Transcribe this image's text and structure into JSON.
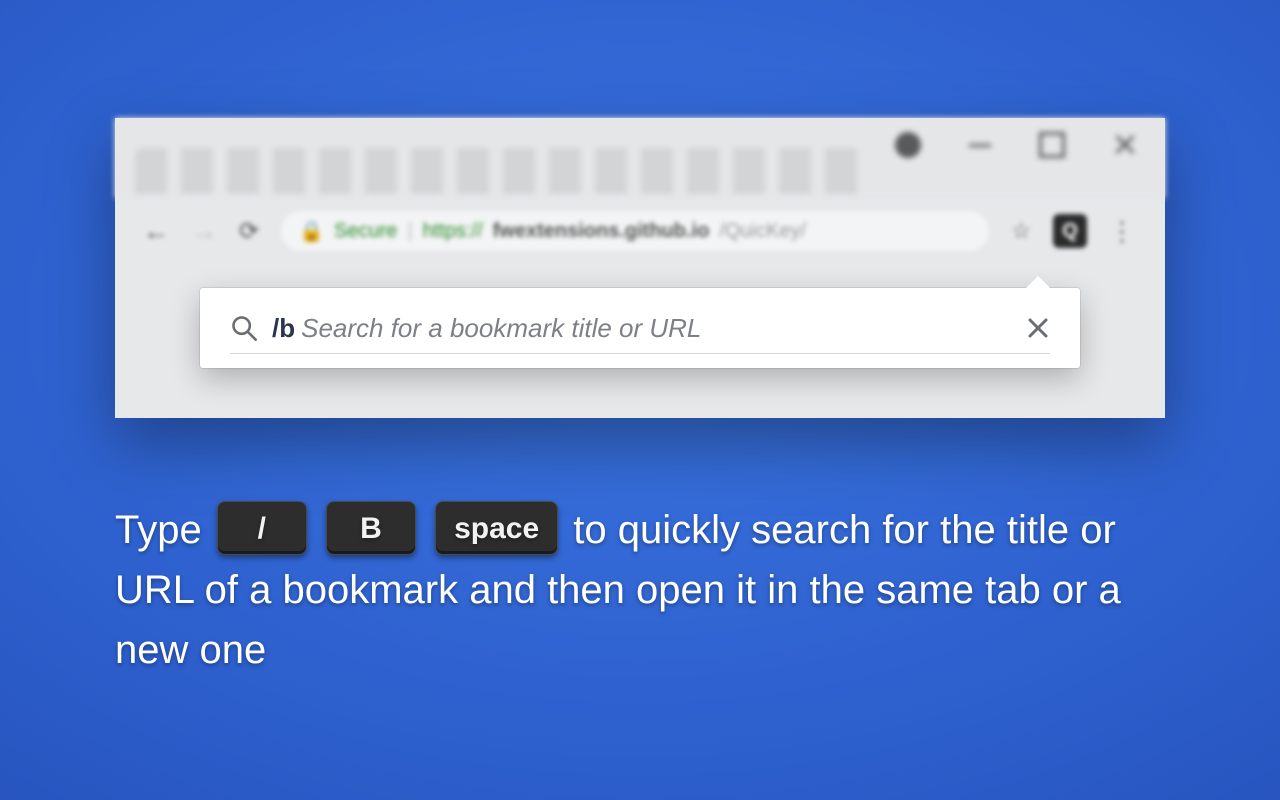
{
  "browser": {
    "secure_label": "Secure",
    "url_scheme": "https://",
    "url_host": "fwextensions.github.io",
    "url_path": "/QuicKey/"
  },
  "extension": {
    "badge_letter": "Q"
  },
  "popup": {
    "prefix": "/b",
    "placeholder": "Search for a bookmark title or URL"
  },
  "caption": {
    "prefix": "Type ",
    "key1": "/",
    "key2": "B",
    "key3": "space",
    "rest": " to quickly search for the title or URL of a bookmark and then open it in the same tab or a new one"
  }
}
